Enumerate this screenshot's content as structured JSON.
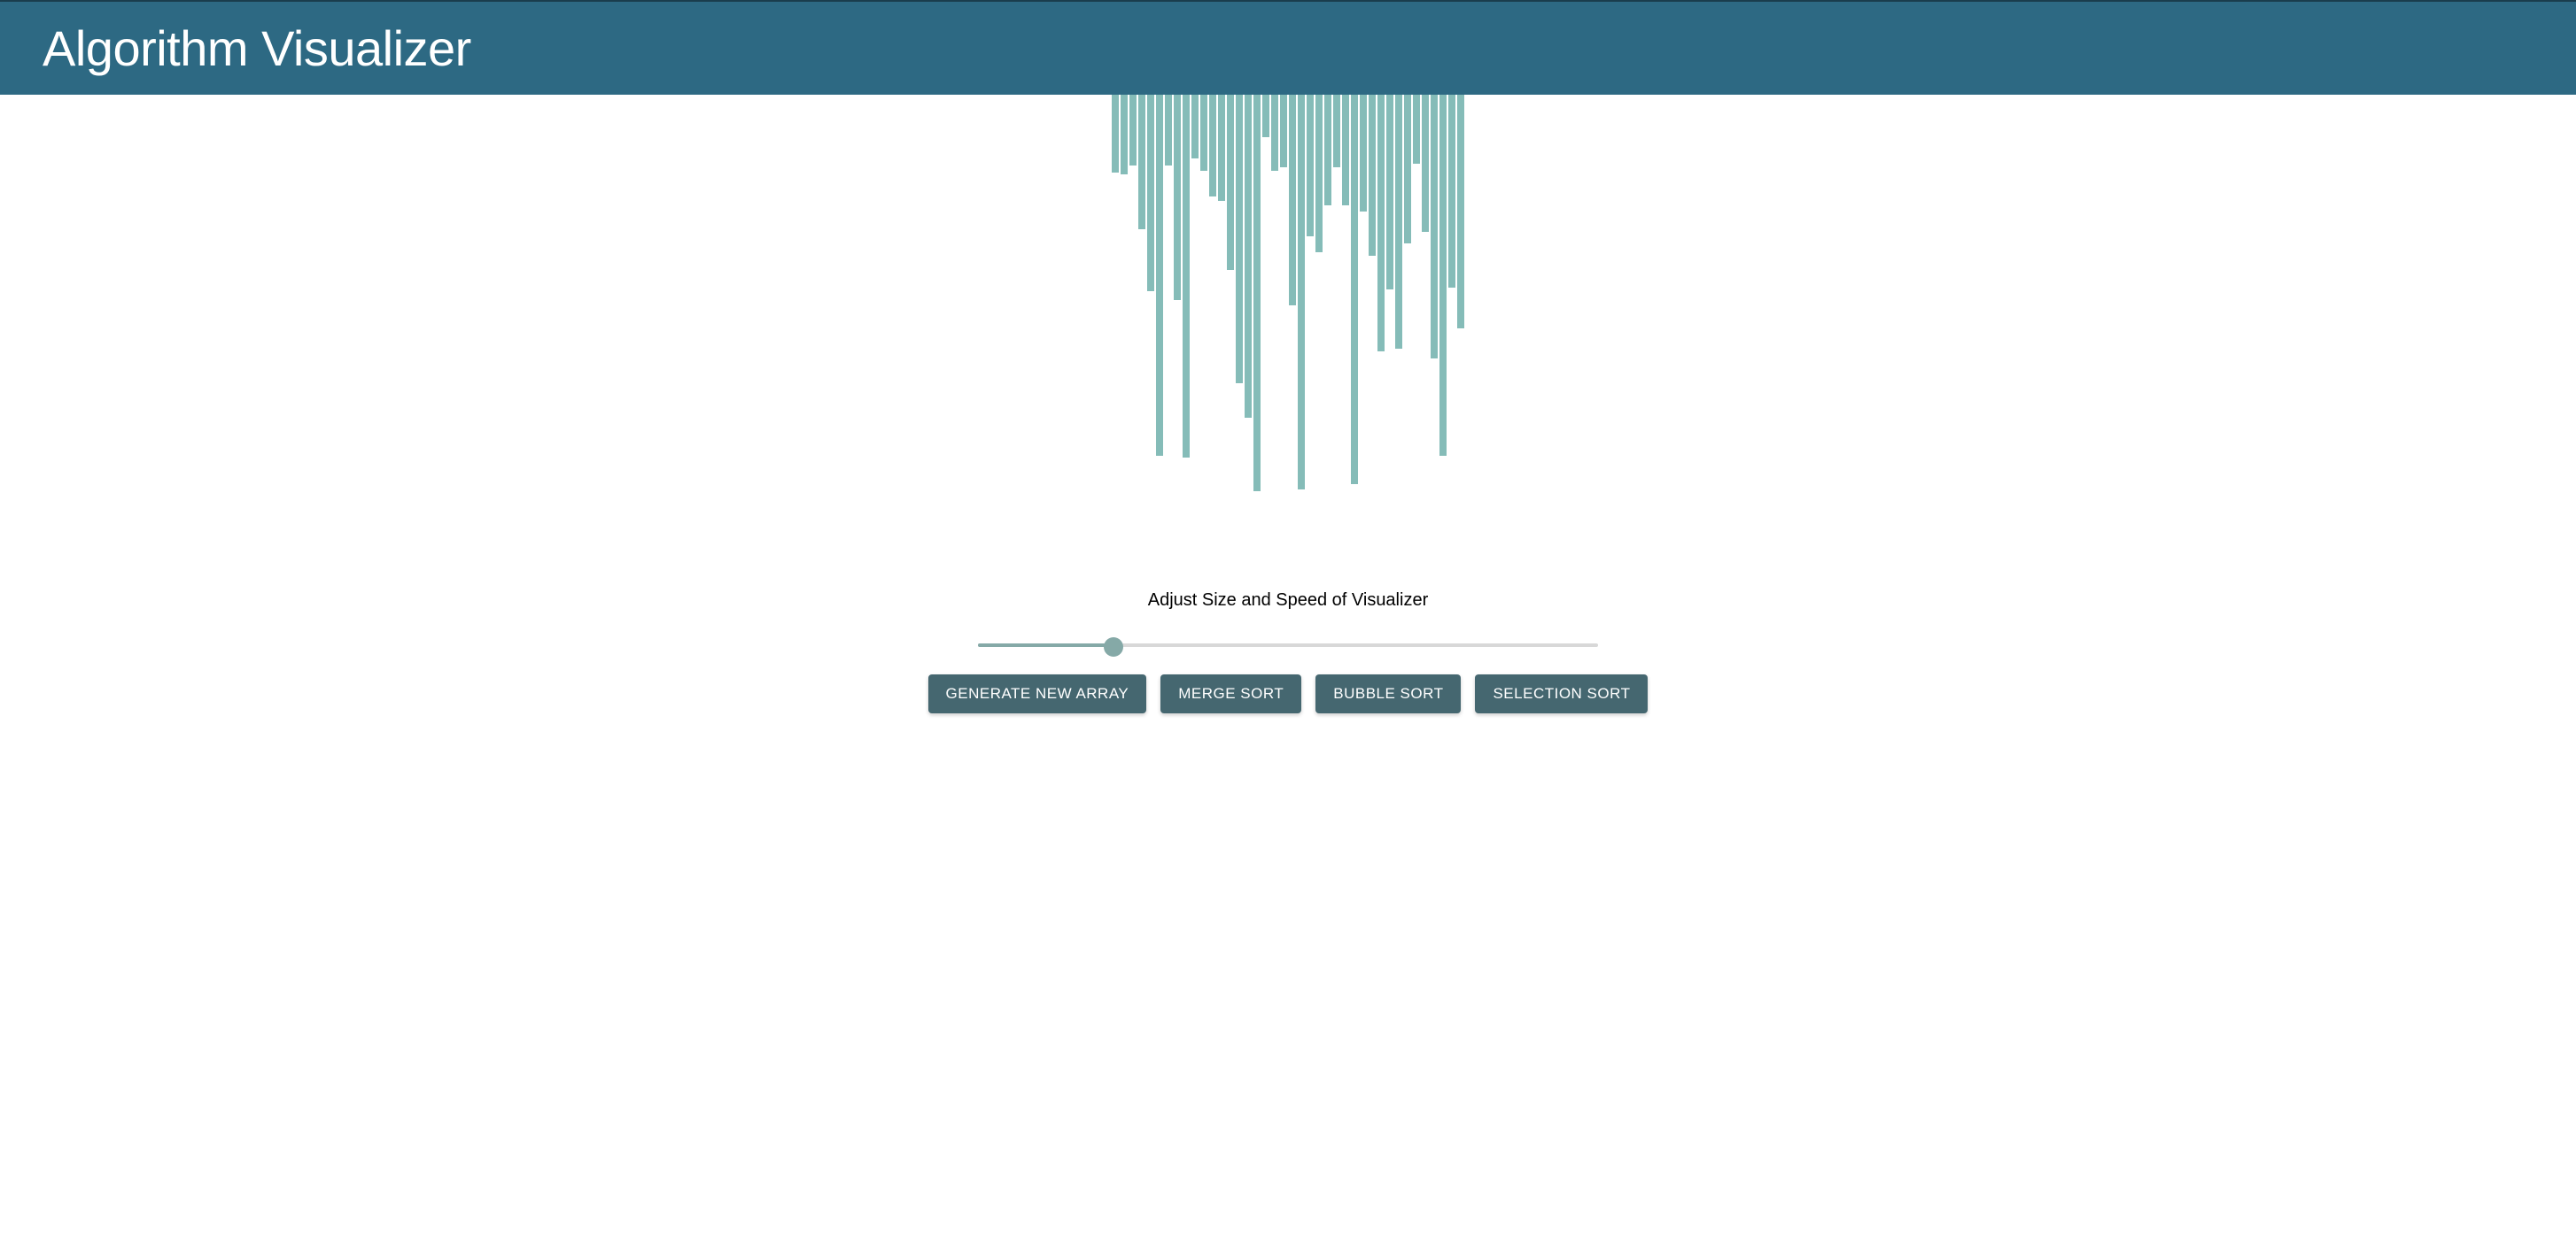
{
  "header": {
    "title": "Algorithm Visualizer"
  },
  "chart_data": {
    "type": "bar",
    "values": [
      88,
      90,
      80,
      152,
      222,
      408,
      80,
      232,
      410,
      72,
      86,
      115,
      120,
      198,
      326,
      365,
      448,
      48,
      86,
      82,
      238,
      446,
      160,
      178,
      125,
      82,
      125,
      440,
      132,
      182,
      290,
      220,
      287,
      168,
      78,
      155,
      298,
      408,
      218,
      264
    ]
  },
  "controls": {
    "slider_label": "Adjust Size and Speed of Visualizer",
    "slider_value": 21,
    "slider_min": 0,
    "slider_max": 100,
    "buttons": {
      "generate": "GENERATE NEW ARRAY",
      "merge": "MERGE SORT",
      "bubble": "BUBBLE SORT",
      "selection": "SELECTION SORT"
    }
  }
}
